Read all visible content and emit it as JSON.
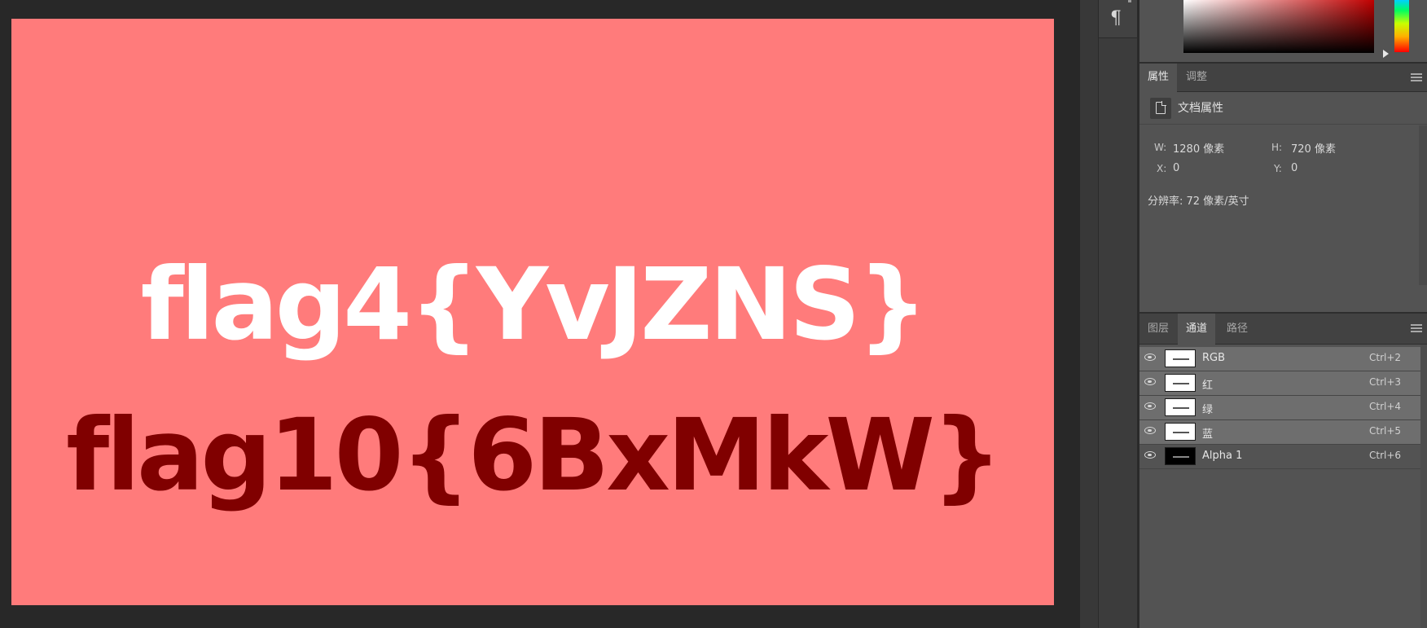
{
  "canvas": {
    "background_color": "#ff7b7b",
    "line1": "flag4{YvJZNS}",
    "line1_color": "#ffffff",
    "line2": "flag10{6BxMkW}",
    "line2_color": "#800000"
  },
  "tools": {
    "paragraph_icon": "¶"
  },
  "properties_panel": {
    "tabs": [
      "属性",
      "调整"
    ],
    "active_tab": "属性",
    "section_title": "文档属性",
    "w_label": "W:",
    "w_value": "1280 像素",
    "h_label": "H:",
    "h_value": "720 像素",
    "x_label": "X:",
    "x_value": "0",
    "y_label": "Y:",
    "y_value": "0",
    "resolution": "分辨率: 72 像素/英寸"
  },
  "channels_panel": {
    "tabs": [
      "图层",
      "通道",
      "路径"
    ],
    "active_tab": "通道",
    "channels": [
      {
        "name": "RGB",
        "shortcut": "Ctrl+2",
        "visible": true,
        "selected": true
      },
      {
        "name": "红",
        "shortcut": "Ctrl+3",
        "visible": true,
        "selected": true
      },
      {
        "name": "绿",
        "shortcut": "Ctrl+4",
        "visible": true,
        "selected": true
      },
      {
        "name": "蓝",
        "shortcut": "Ctrl+5",
        "visible": true,
        "selected": true
      },
      {
        "name": "Alpha 1",
        "shortcut": "Ctrl+6",
        "visible": true,
        "selected": false
      }
    ]
  },
  "icons": [
    "paragraph-icon",
    "panel-menu-icon",
    "document-icon",
    "eye-icon"
  ]
}
